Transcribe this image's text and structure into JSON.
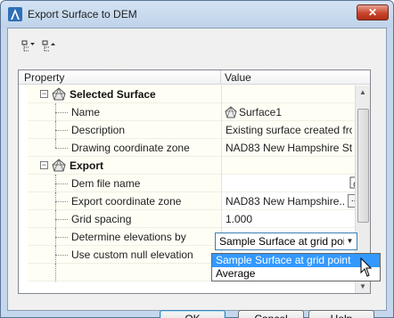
{
  "window": {
    "title": "Export Surface to DEM",
    "close_glyph": "✕"
  },
  "toolbar": {
    "icons": [
      "categorized-view-icon",
      "alphabetical-view-icon"
    ]
  },
  "grid": {
    "header": {
      "property": "Property",
      "value": "Value"
    },
    "categories": [
      {
        "label": "Selected Surface",
        "rows": [
          {
            "label": "Name",
            "value": "Surface1"
          },
          {
            "label": "Description",
            "value": "Existing surface created fro..."
          },
          {
            "label": "Drawing coordinate zone",
            "value": "NAD83 New Hampshire St..."
          }
        ]
      },
      {
        "label": "Export",
        "rows": [
          {
            "label": "Dem file name",
            "value": ""
          },
          {
            "label": "Export coordinate zone",
            "value": "NAD83 New Hampshire..."
          },
          {
            "label": "Grid spacing",
            "value": "1.000"
          },
          {
            "label": "Determine elevations by",
            "value": "Sample Surface at grid poi"
          },
          {
            "label": "Use custom null elevation",
            "value": ""
          }
        ]
      }
    ],
    "ellipsis": "..."
  },
  "dropdown": {
    "options": [
      "Sample Surface at grid point",
      "Average"
    ],
    "selected_index": 0
  },
  "buttons": {
    "ok": "OK",
    "cancel": "Cancel",
    "help": "Help"
  },
  "colors": {
    "accent": "#3399ff",
    "title_bg": "#c4d7ec",
    "close": "#c8442c",
    "grid_bg": "#fffef5"
  }
}
